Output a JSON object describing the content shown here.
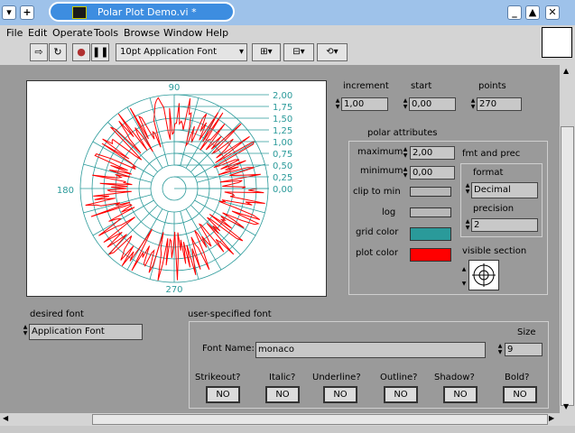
{
  "window": {
    "title": "Polar Plot Demo.vi *"
  },
  "menu": {
    "items": [
      "File",
      "Edit",
      "Operate",
      "Tools",
      "Browse",
      "Window",
      "Help"
    ]
  },
  "toolbar": {
    "font_select": "10pt Application Font"
  },
  "graph": {
    "angle_labels": {
      "top": "90",
      "left": "180",
      "bottom": "270"
    },
    "radial_labels": [
      "2,00",
      "1,75",
      "1,50",
      "1,25",
      "1,00",
      "0,75",
      "0,50",
      "0,25",
      "0,00"
    ],
    "grid_color": "#2a9a9a",
    "plot_color": "#ff0000"
  },
  "chart_data": {
    "type": "line",
    "polar": true,
    "radial_range": [
      0,
      2
    ],
    "angle_ticks": [
      90,
      180,
      270
    ],
    "radial_ticks": [
      0,
      0.25,
      0.5,
      0.75,
      1.0,
      1.25,
      1.5,
      1.75,
      2.0
    ],
    "points": 270,
    "increment": 1,
    "start": 0
  },
  "controls": {
    "increment": {
      "label": "increment",
      "value": "1,00"
    },
    "start": {
      "label": "start",
      "value": "0,00"
    },
    "points": {
      "label": "points",
      "value": "270"
    }
  },
  "polar_attributes": {
    "title": "polar attributes",
    "maximum": {
      "label": "maximum",
      "value": "2,00"
    },
    "minimum": {
      "label": "minimum",
      "value": "0,00"
    },
    "clip_to_min": {
      "label": "clip to min"
    },
    "log": {
      "label": "log"
    },
    "grid_color": {
      "label": "grid color",
      "color": "#2a9a9a"
    },
    "plot_color": {
      "label": "plot color",
      "color": "#ff0000"
    },
    "fmt_and_prec": {
      "label": "fmt and prec",
      "format_label": "format",
      "format_value": "Decimal",
      "precision_label": "precision",
      "precision_value": "2"
    },
    "visible_section": {
      "label": "visible section"
    }
  },
  "desired_font": {
    "label": "desired font",
    "value": "Application Font"
  },
  "user_font": {
    "title": "user-specified font",
    "font_name_label": "Font Name:",
    "font_name_value": "monaco",
    "size_label": "Size",
    "size_value": "9",
    "toggles": [
      {
        "label": "Strikeout?",
        "value": "NO"
      },
      {
        "label": "Italic?",
        "value": "NO"
      },
      {
        "label": "Underline?",
        "value": "NO"
      },
      {
        "label": "Outline?",
        "value": "NO"
      },
      {
        "label": "Shadow?",
        "value": "NO"
      },
      {
        "label": "Bold?",
        "value": "NO"
      }
    ]
  }
}
